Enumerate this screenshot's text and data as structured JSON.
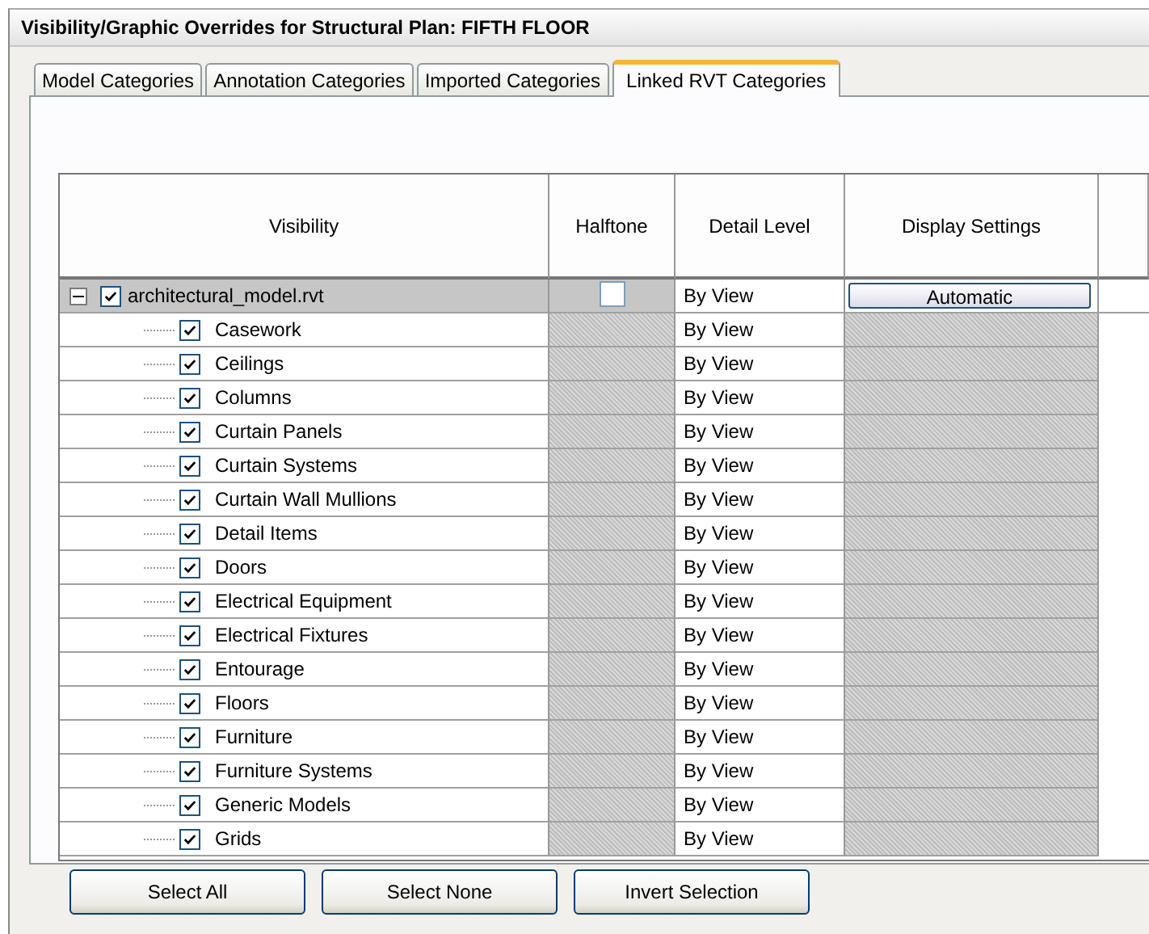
{
  "window": {
    "title": "Visibility/Graphic Overrides for Structural Plan: FIFTH FLOOR"
  },
  "tabs": [
    {
      "label": "Model Categories",
      "selected": false
    },
    {
      "label": "Annotation Categories",
      "selected": false
    },
    {
      "label": "Imported Categories",
      "selected": false
    },
    {
      "label": "Linked RVT Categories",
      "selected": true
    }
  ],
  "table": {
    "columns": [
      "Visibility",
      "Halftone",
      "Detail Level",
      "Display Settings"
    ],
    "rows": [
      {
        "name": "architectural_model.rvt",
        "expanded": true,
        "checked": true,
        "halftone": false,
        "detail_level": "By View",
        "display_settings": "Automatic",
        "children": [
          {
            "name": "Casework",
            "checked": true,
            "detail_level": "By View"
          },
          {
            "name": "Ceilings",
            "checked": true,
            "detail_level": "By View"
          },
          {
            "name": "Columns",
            "checked": true,
            "detail_level": "By View"
          },
          {
            "name": "Curtain Panels",
            "checked": true,
            "detail_level": "By View"
          },
          {
            "name": "Curtain Systems",
            "checked": true,
            "detail_level": "By View"
          },
          {
            "name": "Curtain Wall Mullions",
            "checked": true,
            "detail_level": "By View"
          },
          {
            "name": "Detail Items",
            "checked": true,
            "detail_level": "By View"
          },
          {
            "name": "Doors",
            "checked": true,
            "detail_level": "By View"
          },
          {
            "name": "Electrical Equipment",
            "checked": true,
            "detail_level": "By View"
          },
          {
            "name": "Electrical Fixtures",
            "checked": true,
            "detail_level": "By View"
          },
          {
            "name": "Entourage",
            "checked": true,
            "detail_level": "By View"
          },
          {
            "name": "Floors",
            "checked": true,
            "detail_level": "By View"
          },
          {
            "name": "Furniture",
            "checked": true,
            "detail_level": "By View"
          },
          {
            "name": "Furniture Systems",
            "checked": true,
            "detail_level": "By View"
          },
          {
            "name": "Generic Models",
            "checked": true,
            "detail_level": "By View"
          },
          {
            "name": "Grids",
            "checked": true,
            "detail_level": "By View"
          }
        ]
      }
    ]
  },
  "buttons": [
    "Select All",
    "Select None",
    "Invert Selection"
  ]
}
